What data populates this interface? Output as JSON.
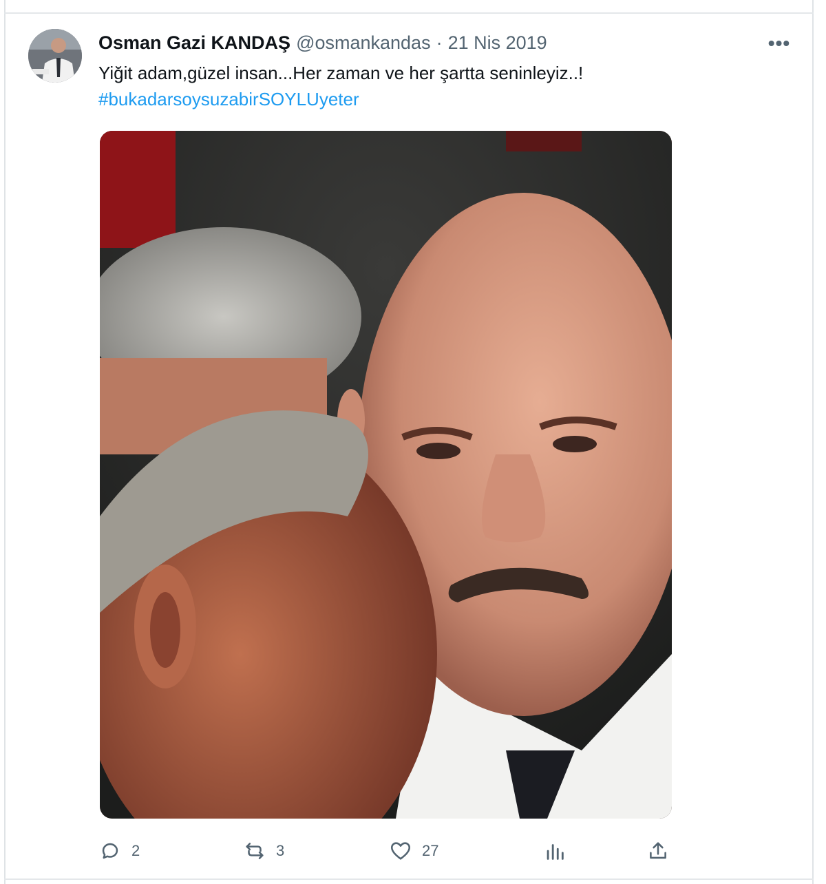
{
  "tweet": {
    "author_name": "Osman Gazi KANDAŞ",
    "handle": "@osmankandas",
    "separator": "·",
    "date": "21 Nis 2019",
    "text": "Yiğit adam,güzel insan...Her zaman ve her şartta seninleyiz..!",
    "hashtag": "#bukadarsoysuzabirSOYLUyeter",
    "more_label": "•••"
  },
  "actions": {
    "replies": "2",
    "retweets": "3",
    "likes": "27"
  },
  "icons": {
    "reply": "reply-icon",
    "retweet": "retweet-icon",
    "like": "heart-icon",
    "views": "views-icon",
    "share": "share-icon",
    "more": "more-icon"
  },
  "colors": {
    "link": "#1d9bf0",
    "muted": "#536471",
    "text": "#0f1419"
  }
}
